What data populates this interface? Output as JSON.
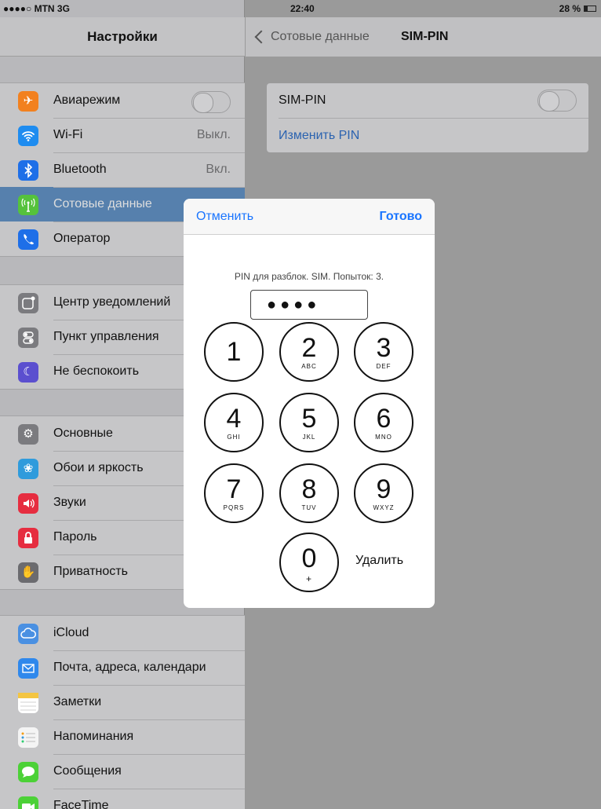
{
  "status": {
    "carrier": "●●●●○ MTN  3G",
    "time": "22:40",
    "battery": "28 %",
    "battery_level_fraction": 0.28
  },
  "sidebar": {
    "title": "Настройки",
    "groups": [
      [
        {
          "label": "Авиарежим",
          "icon": "airplane-icon",
          "color": "#f2811f",
          "control": "toggle",
          "value": ""
        },
        {
          "label": "Wi-Fi",
          "icon": "wifi-icon",
          "color": "#1e8cf0",
          "value": "Выкл."
        },
        {
          "label": "Bluetooth",
          "icon": "bluetooth-icon",
          "color": "#1e6fe8",
          "value": "Вкл."
        },
        {
          "label": "Сотовые данные",
          "icon": "cellular-icon",
          "color": "#55c23c",
          "value": "",
          "selected": true
        },
        {
          "label": "Оператор",
          "icon": "phone-icon",
          "color": "#1e6fe8",
          "value": ""
        }
      ],
      [
        {
          "label": "Центр уведомлений",
          "icon": "notifications-icon",
          "color": "#7b7b7f",
          "value": ""
        },
        {
          "label": "Пункт управления",
          "icon": "control-center-icon",
          "color": "#7b7b7f",
          "value": ""
        },
        {
          "label": "Не беспокоить",
          "icon": "moon-icon",
          "color": "#5b4fcf",
          "value": ""
        }
      ],
      [
        {
          "label": "Основные",
          "icon": "gear-icon",
          "color": "#7b7b7f",
          "value": ""
        },
        {
          "label": "Обои и яркость",
          "icon": "wallpaper-icon",
          "color": "#2f9bdc",
          "value": ""
        },
        {
          "label": "Звуки",
          "icon": "speaker-icon",
          "color": "#e62d40",
          "value": ""
        },
        {
          "label": "Пароль",
          "icon": "lock-icon",
          "color": "#e62d40",
          "value": ""
        },
        {
          "label": "Приватность",
          "icon": "hand-icon",
          "color": "#6b6b6f",
          "value": ""
        }
      ],
      [
        {
          "label": "iCloud",
          "icon": "cloud-icon",
          "color": "#4a90e2",
          "value": ""
        },
        {
          "label": "Почта, адреса, календари",
          "icon": "mail-icon",
          "color": "#2f88ec",
          "value": ""
        },
        {
          "label": "Заметки",
          "icon": "notes-icon",
          "color": "#f4c542",
          "value": ""
        },
        {
          "label": "Напоминания",
          "icon": "reminders-icon",
          "color": "#e0e0e0",
          "value": ""
        },
        {
          "label": "Сообщения",
          "icon": "messages-icon",
          "color": "#4cd137",
          "value": ""
        },
        {
          "label": "FaceTime",
          "icon": "facetime-icon",
          "color": "#4cd137",
          "value": ""
        }
      ]
    ]
  },
  "detail": {
    "back_label": "Сотовые данные",
    "title": "SIM-PIN",
    "sim_pin_label": "SIM-PIN",
    "change_pin_label": "Изменить PIN"
  },
  "modal": {
    "cancel_label": "Отменить",
    "done_label": "Готово",
    "prompt": "PIN для разблок. SIM. Попыток: 3.",
    "pin_value": "●●●●",
    "delete_label": "Удалить",
    "keys": [
      {
        "digit": "1",
        "letters": ""
      },
      {
        "digit": "2",
        "letters": "ABC"
      },
      {
        "digit": "3",
        "letters": "DEF"
      },
      {
        "digit": "4",
        "letters": "GHI"
      },
      {
        "digit": "5",
        "letters": "JKL"
      },
      {
        "digit": "6",
        "letters": "MNO"
      },
      {
        "digit": "7",
        "letters": "PQRS"
      },
      {
        "digit": "8",
        "letters": "TUV"
      },
      {
        "digit": "9",
        "letters": "WXYZ"
      },
      {
        "digit": "0",
        "letters": "+"
      }
    ]
  }
}
